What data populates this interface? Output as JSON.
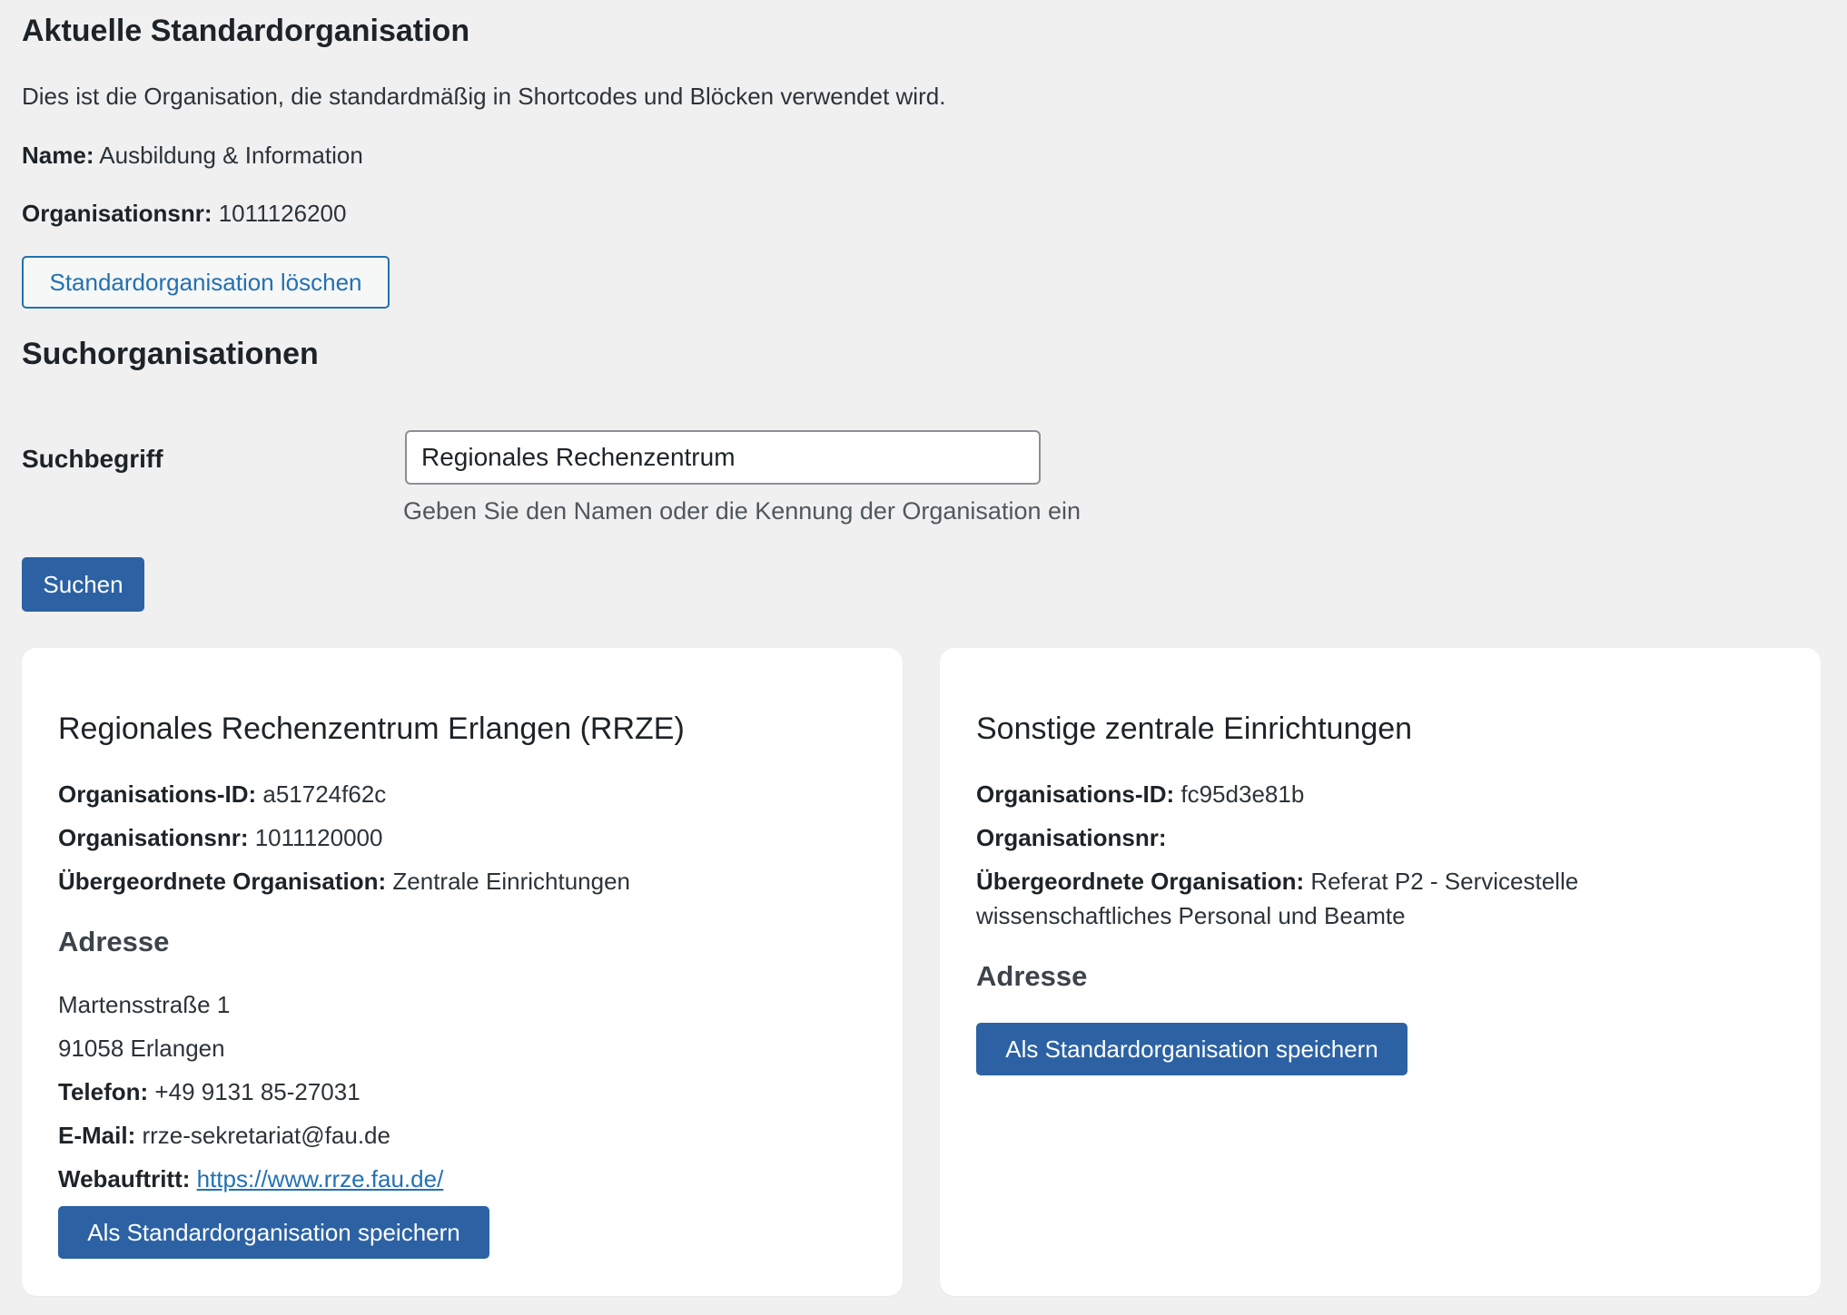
{
  "current": {
    "heading": "Aktuelle Standardorganisation",
    "description": "Dies ist die Organisation, die standardmäßig in Shortcodes und Blöcken verwendet wird.",
    "name_label": "Name:",
    "name_value": "Ausbildung & Information",
    "orgnr_label": "Organisationsnr:",
    "orgnr_value": "1011126200",
    "delete_button": "Standardorganisation löschen"
  },
  "search": {
    "heading": "Suchorganisationen",
    "field_label": "Suchbegriff",
    "field_value": "Regionales Rechenzentrum",
    "help": "Geben Sie den Namen oder die Kennung der Organisation ein",
    "button": "Suchen"
  },
  "results": [
    {
      "title": "Regionales Rechenzentrum Erlangen (RRZE)",
      "id_label": "Organisations-ID:",
      "id_value": "a51724f62c",
      "nr_label": "Organisationsnr:",
      "nr_value": "1011120000",
      "parent_label": "Übergeordnete Organisation:",
      "parent_value": "Zentrale Einrichtungen",
      "address_heading": "Adresse",
      "street": "Martensstraße 1",
      "city": "91058 Erlangen",
      "phone_label": "Telefon:",
      "phone_value": "+49 9131 85-27031",
      "email_label": "E-Mail:",
      "email_value": "rrze-sekretariat@fau.de",
      "web_label": "Webauftritt:",
      "web_value": "https://www.rrze.fau.de/",
      "save_button": "Als Standardorganisation speichern"
    },
    {
      "title": "Sonstige zentrale Einrichtungen",
      "id_label": "Organisations-ID:",
      "id_value": "fc95d3e81b",
      "nr_label": "Organisationsnr:",
      "nr_value": "",
      "parent_label": "Übergeordnete Organisation:",
      "parent_value": "Referat P2 - Servicestelle",
      "parent_value_line2": "wissenschaftliches Personal und Beamte",
      "address_heading": "Adresse",
      "save_button": "Als Standardorganisation speichern"
    }
  ],
  "colors": {
    "primary": "#2c62a3",
    "link": "#2271b1",
    "background": "#f0f0f1",
    "card": "#ffffff"
  }
}
